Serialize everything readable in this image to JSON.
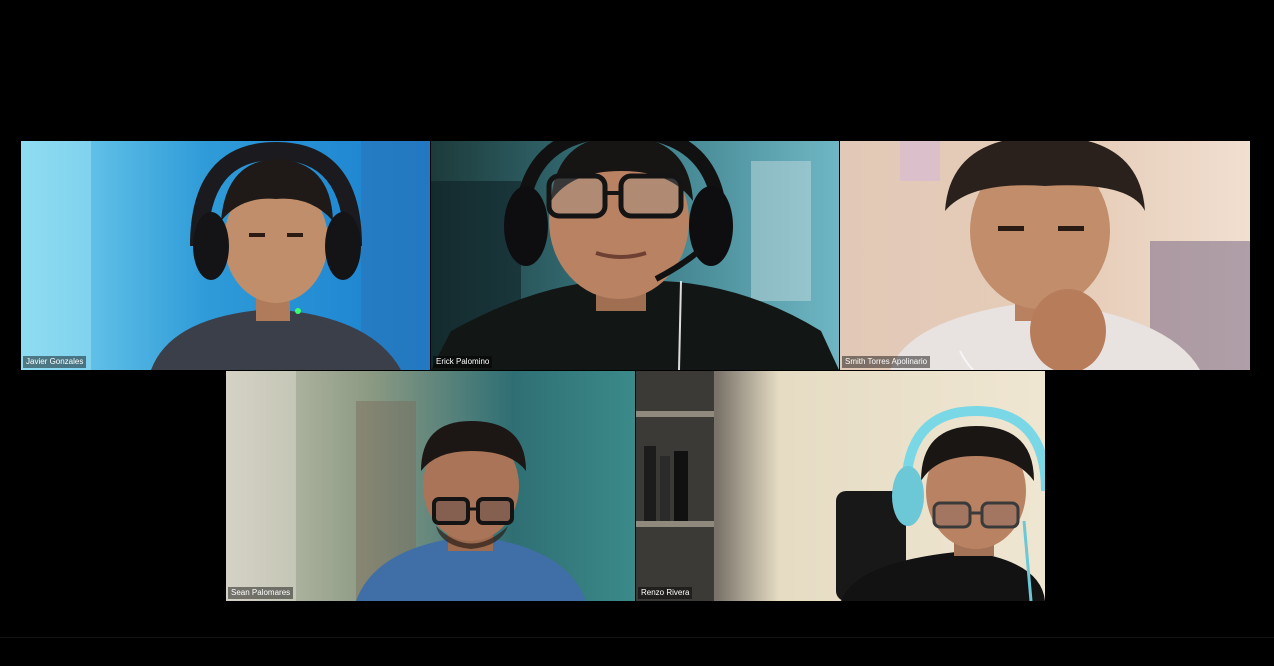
{
  "participants": [
    {
      "name": "Javier Gonzales"
    },
    {
      "name": "Erick Palomino"
    },
    {
      "name": "Smith Torres Apolinario"
    },
    {
      "name": "Sean Palomares"
    },
    {
      "name": "Renzo Rivera"
    }
  ]
}
